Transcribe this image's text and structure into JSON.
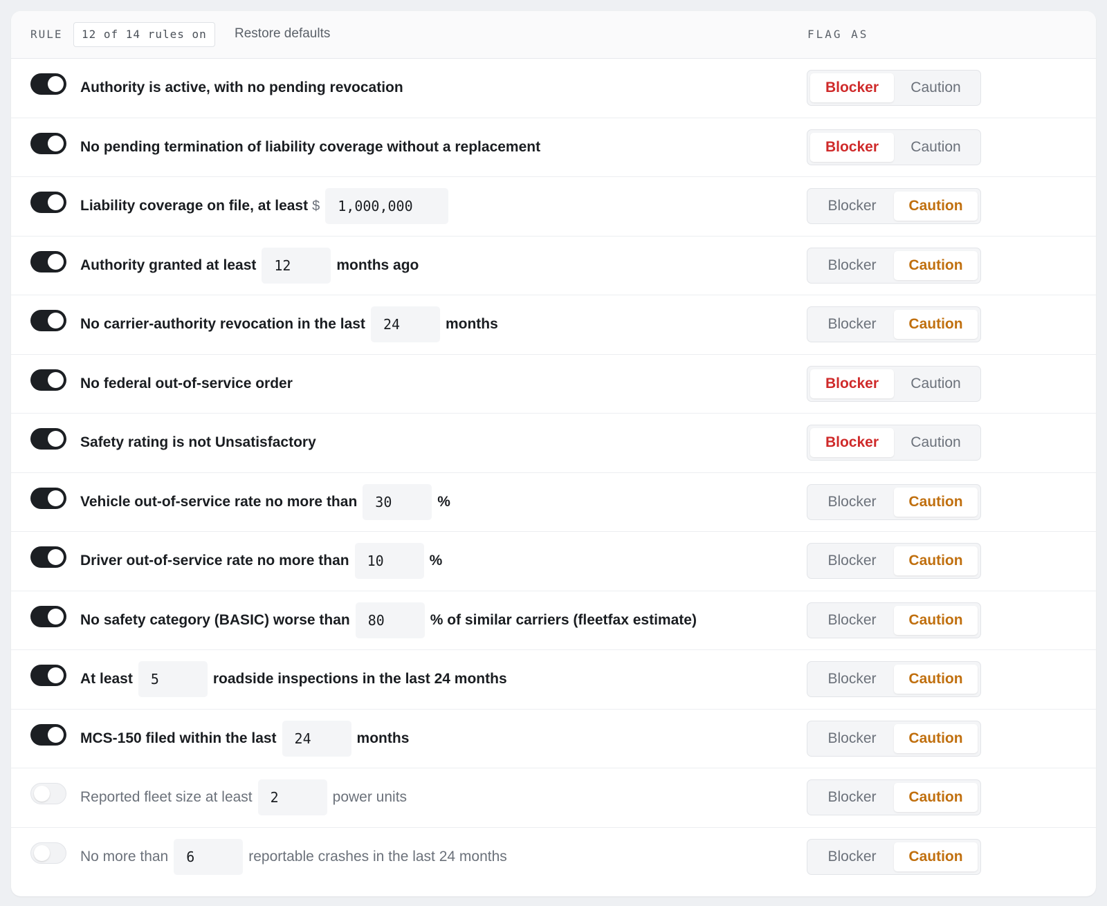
{
  "header": {
    "rule_label": "RULE",
    "rules_count": "12 of 14 rules on",
    "restore_label": "Restore defaults",
    "flag_label": "FLAG AS"
  },
  "flag_options": {
    "blocker": "Blocker",
    "caution": "Caution"
  },
  "colors": {
    "blocker": "#cf2a2a",
    "caution": "#c06f0e",
    "toggle_on": "#1c1f23"
  },
  "rules": [
    {
      "enabled": true,
      "flag": "blocker",
      "before": "Authority is active, with no pending revocation"
    },
    {
      "enabled": true,
      "flag": "blocker",
      "before": "No pending termination of liability coverage without a replacement"
    },
    {
      "enabled": true,
      "flag": "caution",
      "before": "Liability coverage on file, at least",
      "prefix": "$",
      "value": "1,000,000"
    },
    {
      "enabled": true,
      "flag": "caution",
      "before": "Authority granted at least",
      "value": "12",
      "after": "months ago"
    },
    {
      "enabled": true,
      "flag": "caution",
      "before": "No carrier-authority revocation in the last",
      "value": "24",
      "after": "months"
    },
    {
      "enabled": true,
      "flag": "blocker",
      "before": "No federal out-of-service order"
    },
    {
      "enabled": true,
      "flag": "blocker",
      "before": "Safety rating is not Unsatisfactory"
    },
    {
      "enabled": true,
      "flag": "caution",
      "before": "Vehicle out-of-service rate no more than",
      "value": "30",
      "after": "%"
    },
    {
      "enabled": true,
      "flag": "caution",
      "before": "Driver out-of-service rate no more than",
      "value": "10",
      "after": "%"
    },
    {
      "enabled": true,
      "flag": "caution",
      "before": "No safety category (BASIC) worse than",
      "value": "80",
      "after": "% of similar carriers (fleetfax estimate)"
    },
    {
      "enabled": true,
      "flag": "caution",
      "before": "At least",
      "value": "5",
      "after": "roadside inspections in the last 24 months"
    },
    {
      "enabled": true,
      "flag": "caution",
      "before": "MCS-150 filed within the last",
      "value": "24",
      "after": "months"
    },
    {
      "enabled": false,
      "flag": "caution",
      "before": "Reported fleet size at least",
      "value": "2",
      "after": "power units"
    },
    {
      "enabled": false,
      "flag": "caution",
      "before": "No more than",
      "value": "6",
      "after": "reportable crashes in the last 24 months"
    }
  ]
}
